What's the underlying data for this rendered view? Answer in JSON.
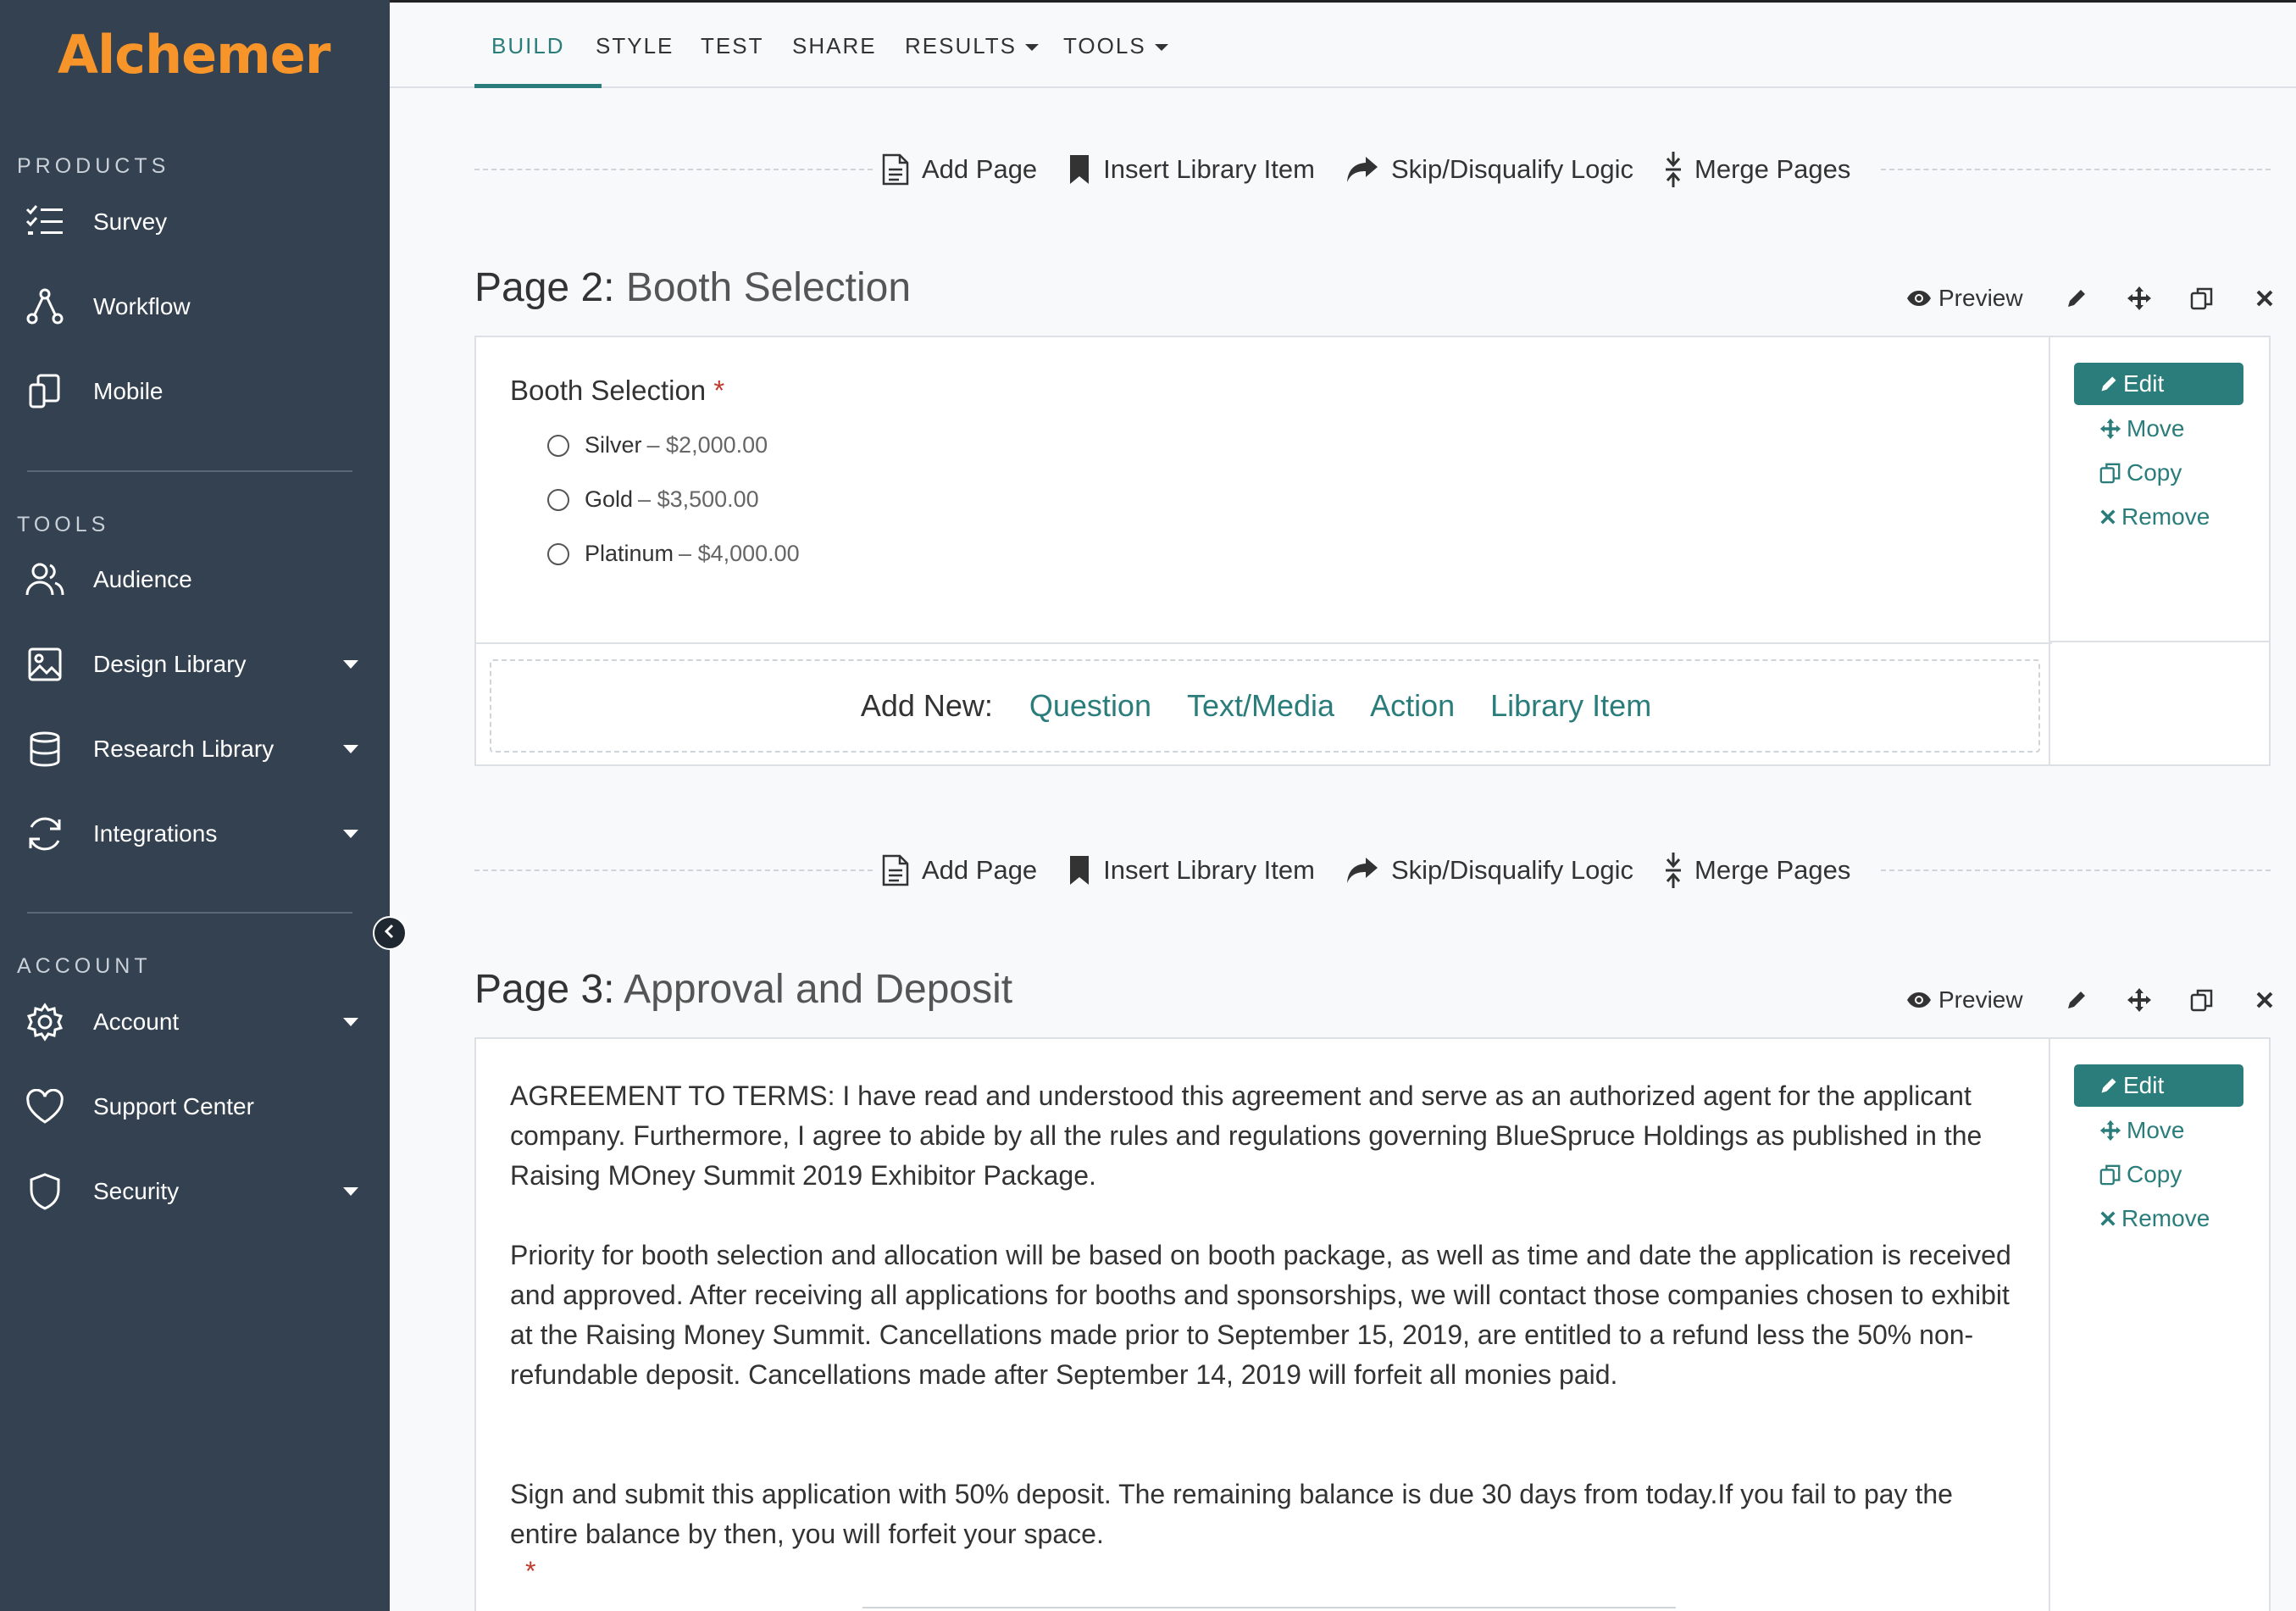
{
  "app": {
    "logo": "Alchemer"
  },
  "sidebar": {
    "sections": {
      "products": "PRODUCTS",
      "tools": "TOOLS",
      "account": "ACCOUNT"
    },
    "items": [
      {
        "label": "Survey",
        "icon": "survey-list-icon"
      },
      {
        "label": "Workflow",
        "icon": "workflow-icon"
      },
      {
        "label": "Mobile",
        "icon": "mobile-icon"
      },
      {
        "label": "Audience",
        "icon": "audience-icon"
      },
      {
        "label": "Design Library",
        "icon": "image-icon"
      },
      {
        "label": "Research Library",
        "icon": "database-icon"
      },
      {
        "label": "Integrations",
        "icon": "sync-icon"
      },
      {
        "label": "Account",
        "icon": "gear-icon"
      },
      {
        "label": "Support Center",
        "icon": "heart-icon"
      },
      {
        "label": "Security",
        "icon": "shield-icon"
      }
    ]
  },
  "topnav": {
    "tabs": [
      {
        "label": "BUILD"
      },
      {
        "label": "STYLE"
      },
      {
        "label": "TEST"
      },
      {
        "label": "SHARE"
      },
      {
        "label": "RESULTS"
      },
      {
        "label": "TOOLS"
      }
    ],
    "active_tab": "BUILD"
  },
  "actionbar": {
    "add_page": "Add Page",
    "insert_library_item": "Insert Library Item",
    "skip_logic": "Skip/Disqualify Logic",
    "merge_pages": "Merge Pages"
  },
  "page_tools": {
    "preview": "Preview"
  },
  "side_actions": {
    "edit": "Edit",
    "move": "Move",
    "copy": "Copy",
    "remove": "Remove"
  },
  "page2": {
    "prefix": "Page 2:",
    "name": "Booth Selection",
    "question": {
      "title": "Booth Selection",
      "required_mark": "*",
      "options": [
        {
          "label": "Silver",
          "price": "– $2,000.00"
        },
        {
          "label": "Gold",
          "price": "– $3,500.00"
        },
        {
          "label": "Platinum",
          "price": "– $4,000.00"
        }
      ]
    },
    "add_new": {
      "label": "Add New:",
      "links": [
        "Question",
        "Text/Media",
        "Action",
        "Library Item"
      ]
    }
  },
  "page3": {
    "prefix": "Page 3:",
    "name": "Approval and Deposit",
    "paragraphs": [
      "AGREEMENT TO TERMS: I have read and understood this agreement and serve as an authorized agent for the applicant company. Furthermore, I agree to abide by all the rules and regulations governing BlueSpruce Holdings as published in the Raising MOney Summit 2019 Exhibitor Package.",
      "Priority for booth selection and allocation will be based on booth package, as well as time and date the application is received and approved. After receiving all applications for booths and sponsorships, we will contact those companies chosen to exhibit at the Raising Money Summit. Cancellations made prior to September 15, 2019, are entitled to a refund less the 50% non-refundable deposit. Cancellations made after September 14, 2019 will forfeit all monies paid.",
      "Sign and submit this application with 50% deposit. The remaining balance is due 30 days from today.If you fail to pay the entire balance by then, you will forfeit your space."
    ],
    "required_mark": "*"
  },
  "colors": {
    "accent": "#2a7d7b",
    "sidebar_bg": "#334150",
    "logo": "#f7952b",
    "required": "#c0392b"
  }
}
